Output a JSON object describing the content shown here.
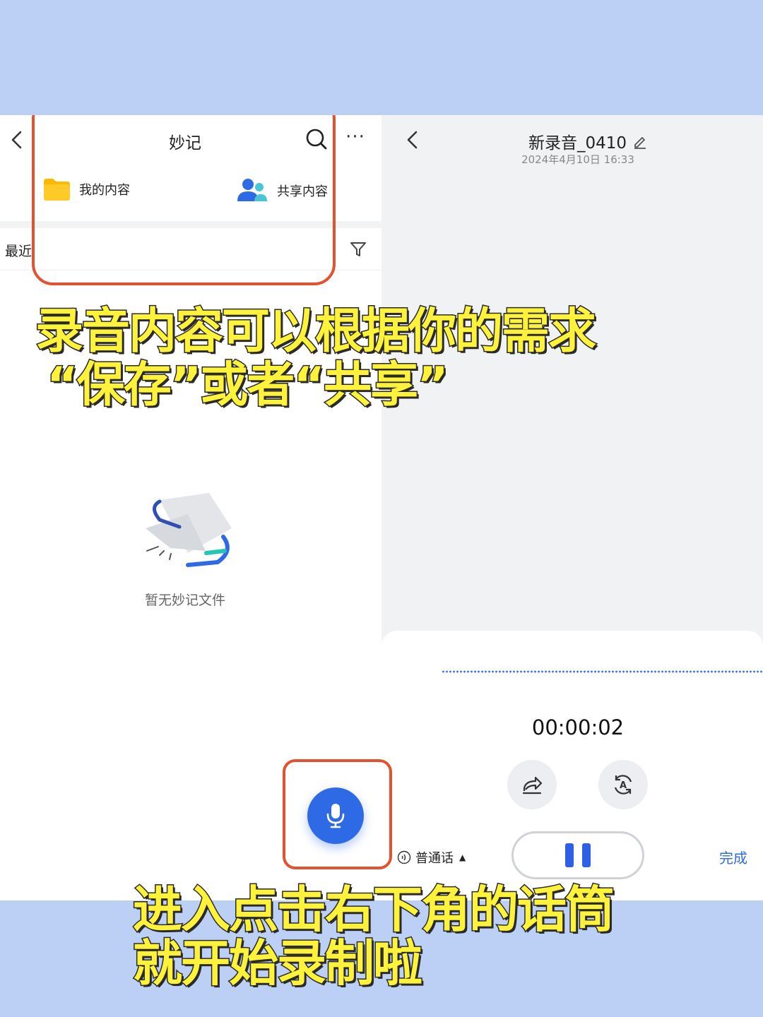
{
  "left_panel": {
    "title": "妙记",
    "categories": [
      {
        "label": "我的内容",
        "icon": "folder-icon",
        "color": "#fbb900"
      },
      {
        "label": "共享内容",
        "icon": "people-icon",
        "color": "#2f6ae6"
      }
    ],
    "recent_label": "最近",
    "empty_text": "暂无妙记文件"
  },
  "right_panel": {
    "title": "新录音_0410",
    "date": "2024年4月10日 16:33",
    "timer": "00:00:02",
    "language": "普通话",
    "done_label": "完成"
  },
  "captions": {
    "top_line1": "录音内容可以根据你的需求",
    "top_line2": "“保存”或者“共享”",
    "bottom_line1": "进入点击右下角的话筒",
    "bottom_line2": "就开始录制啦"
  },
  "colors": {
    "background": "#bcd0f5",
    "accent": "#2f6ae6",
    "highlight": "#e3522f",
    "caption_fill": "#fff23a"
  }
}
